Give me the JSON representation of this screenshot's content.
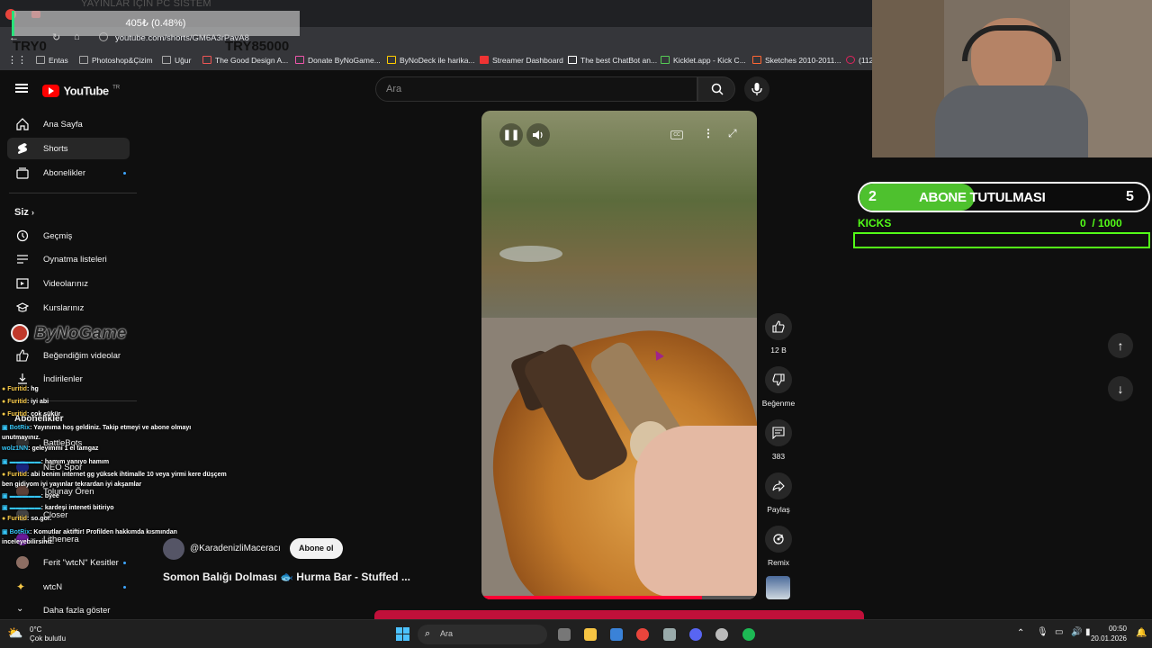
{
  "donation": {
    "title": "YAYINLAR İÇİN PC SİSTEM",
    "amount": "405₺ (0.48%)",
    "progress_percent": 0.48,
    "min_label": "TRY0",
    "max_label": "TRY85000"
  },
  "browser": {
    "url": "youtube.com/shorts/GM6A3rPavA8",
    "bookmarks": [
      "Entas",
      "Photoshop&Çizim",
      "Uğur",
      "The Good Design A...",
      "Donate ByNoGame...",
      "ByNoDeck ile harika...",
      "Streamer Dashboard",
      "The best ChatBot an...",
      "Kicklet.app - Kick C...",
      "Sketches 2010-2011...",
      "(112"
    ]
  },
  "youtube": {
    "logo_text": "YouTube",
    "logo_sup": "TR",
    "search_placeholder": "Ara",
    "nav": [
      {
        "label": "Ana Sayfa"
      },
      {
        "label": "Shorts"
      },
      {
        "label": "Abonelikler"
      }
    ],
    "you_header": "Siz",
    "you_items": [
      {
        "label": "Geçmiş"
      },
      {
        "label": "Oynatma listeleri"
      },
      {
        "label": "Videolarınız"
      },
      {
        "label": "Kurslarınız"
      },
      {
        "label": "Beğendiğim videolar"
      },
      {
        "label": "İndirilenler"
      }
    ],
    "subs_header": "Abonelikler",
    "subs": [
      {
        "label": "BattleBots"
      },
      {
        "label": "NEO Spor"
      },
      {
        "label": "Tolunay Ören"
      },
      {
        "label": "Closer"
      },
      {
        "label": "Lithenera"
      },
      {
        "label": "Ferit \"wtcN\" Kesitler"
      },
      {
        "label": "wtcN"
      }
    ],
    "show_more": "Daha fazla göster"
  },
  "short": {
    "channel": "@KaradenizliMaceracı",
    "subscribe_label": "Abone ol",
    "title": "Somon Balığı Dolması 🐟 Hurma Bar - Stuffed ...",
    "likes": "12 B",
    "dislike_label": "Beğenme",
    "comments": "383",
    "share_label": "Paylaş",
    "remix_label": "Remix"
  },
  "chat": {
    "brand": "ByNoGame",
    "messages": [
      {
        "user": "Furitid",
        "text": ": hg"
      },
      {
        "user": "Furitid",
        "text": ": iyi abi"
      },
      {
        "user": "Furitid",
        "text": ": çok şükür"
      },
      {
        "user": "BotRix",
        "text": ": Yayınıma hoş geldiniz. Takip etmeyi ve abone olmayı unutmayınız."
      },
      {
        "user": "wolz1NN",
        "text": ": geleyimmi 1 el tamgaz"
      },
      {
        "user": "",
        "text": ": hamım yanıyo hamım"
      },
      {
        "user": "Furitid",
        "text": ": abi benim internet gg yüksek ihtimalle 10 veya yirmi kere düşçem ben gidiyom iyi yayınlar tekrardan iyi akşamlar"
      },
      {
        "user": "",
        "text": ": byee"
      },
      {
        "user": "",
        "text": ": kardeşi inteneti bitiriyo"
      },
      {
        "user": "Furitid",
        "text": ": so.gor."
      },
      {
        "user": "BotRix",
        "text": ": Komutlar aktiftir! Profilden hakkımda kısmından inceleyebilirsiniz."
      }
    ]
  },
  "overlay": {
    "sub_goal_left": "2",
    "sub_goal_title": "ABONE TUTULMASI",
    "sub_goal_right": "5",
    "sub_goal_progress": 0.4,
    "kicks_label": "KICKS",
    "kicks_current": "0",
    "kicks_total": "/ 1000"
  },
  "taskbar": {
    "weather_temp": "0°C",
    "weather_text": "Çok bulutlu",
    "search_label": "Ara",
    "time": "00:50",
    "date": "20.01.2026"
  },
  "colors": {
    "youtube_red": "#ff0000",
    "kick_green": "#53fc18",
    "progress_bar": "#c0103a"
  }
}
